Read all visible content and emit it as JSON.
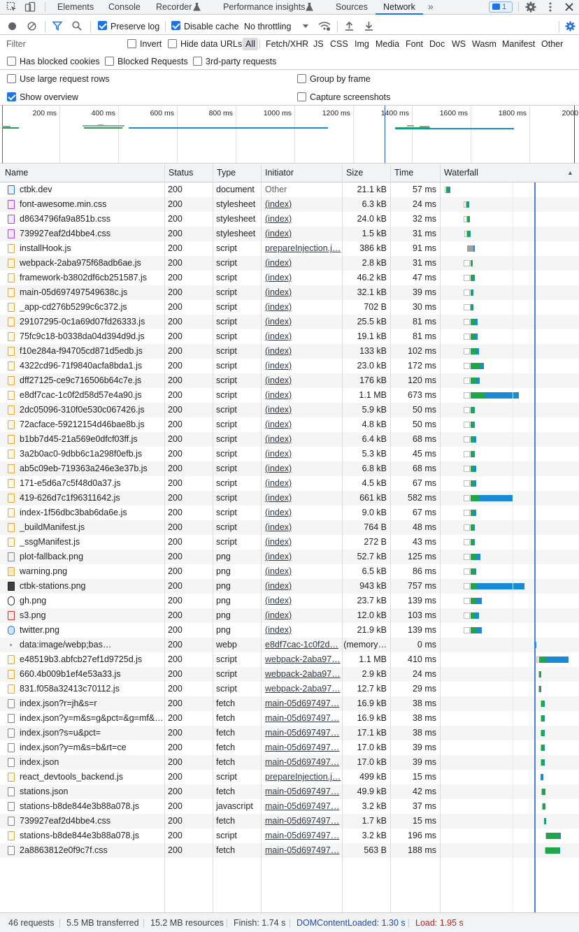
{
  "tabs": [
    {
      "label": "Elements",
      "active": false
    },
    {
      "label": "Console",
      "active": false
    },
    {
      "label": "Recorder",
      "active": false
    },
    {
      "label": "Performance insights",
      "active": false
    },
    {
      "label": "Sources",
      "active": false
    },
    {
      "label": "Network",
      "active": true
    }
  ],
  "issues_count": "1",
  "toolbar": {
    "preserve_log": "Preserve log",
    "disable_cache": "Disable cache",
    "throttling": "No throttling"
  },
  "filter": {
    "placeholder": "Filter",
    "invert": "Invert",
    "hide_data_urls": "Hide data URLs",
    "types": [
      "All",
      "Fetch/XHR",
      "JS",
      "CSS",
      "Img",
      "Media",
      "Font",
      "Doc",
      "WS",
      "Wasm",
      "Manifest",
      "Other"
    ],
    "selected_type": "All"
  },
  "blocked": {
    "has_blocked_cookies": "Has blocked cookies",
    "blocked_requests": "Blocked Requests",
    "third_party": "3rd-party requests"
  },
  "settings": {
    "large_rows": "Use large request rows",
    "group_by_frame": "Group by frame",
    "show_overview": "Show overview",
    "capture_screenshots": "Capture screenshots"
  },
  "overview": {
    "ticks": [
      "200 ms",
      "400 ms",
      "600 ms",
      "800 ms",
      "1000 ms",
      "1200 ms",
      "1400 ms",
      "1600 ms",
      "1800 ms",
      "2000"
    ]
  },
  "columns": [
    "Name",
    "Status",
    "Type",
    "Initiator",
    "Size",
    "Time",
    "Waterfall"
  ],
  "requests": [
    {
      "name": "ctbk.dev",
      "status": "200",
      "type": "document",
      "initiator": "Other",
      "size": "21.1 kB",
      "time": "57 ms",
      "icon": "doc"
    },
    {
      "name": "font-awesome.min.css",
      "status": "200",
      "type": "stylesheet",
      "initiator": "(index)",
      "size": "6.3 kB",
      "time": "24 ms",
      "icon": "css"
    },
    {
      "name": "d8634796fa9a851b.css",
      "status": "200",
      "type": "stylesheet",
      "initiator": "(index)",
      "size": "24.0 kB",
      "time": "32 ms",
      "icon": "css"
    },
    {
      "name": "739927eaf2d4bbe4.css",
      "status": "200",
      "type": "stylesheet",
      "initiator": "(index)",
      "size": "1.5 kB",
      "time": "31 ms",
      "icon": "css"
    },
    {
      "name": "installHook.js",
      "status": "200",
      "type": "script",
      "initiator": "prepareInjection.j…",
      "size": "386 kB",
      "time": "91 ms",
      "icon": "script"
    },
    {
      "name": "webpack-2aba975f68adb6ae.js",
      "status": "200",
      "type": "script",
      "initiator": "(index)",
      "size": "2.8 kB",
      "time": "31 ms",
      "icon": "script"
    },
    {
      "name": "framework-b3802df6cb251587.js",
      "status": "200",
      "type": "script",
      "initiator": "(index)",
      "size": "46.2 kB",
      "time": "47 ms",
      "icon": "script"
    },
    {
      "name": "main-05d697497549638c.js",
      "status": "200",
      "type": "script",
      "initiator": "(index)",
      "size": "32.1 kB",
      "time": "39 ms",
      "icon": "script"
    },
    {
      "name": "_app-cd276b5299c6c372.js",
      "status": "200",
      "type": "script",
      "initiator": "(index)",
      "size": "702 B",
      "time": "30 ms",
      "icon": "script"
    },
    {
      "name": "29107295-0c1a69d07fd26333.js",
      "status": "200",
      "type": "script",
      "initiator": "(index)",
      "size": "25.5 kB",
      "time": "81 ms",
      "icon": "script"
    },
    {
      "name": "75fc9c18-b0338da04d394d9d.js",
      "status": "200",
      "type": "script",
      "initiator": "(index)",
      "size": "19.1 kB",
      "time": "81 ms",
      "icon": "script"
    },
    {
      "name": "f10e284a-f94705cd871d5edb.js",
      "status": "200",
      "type": "script",
      "initiator": "(index)",
      "size": "133 kB",
      "time": "102 ms",
      "icon": "script"
    },
    {
      "name": "4322cd96-71f9840acfa8bda1.js",
      "status": "200",
      "type": "script",
      "initiator": "(index)",
      "size": "23.0 kB",
      "time": "172 ms",
      "icon": "script"
    },
    {
      "name": "dff27125-ce9c716506b64c7e.js",
      "status": "200",
      "type": "script",
      "initiator": "(index)",
      "size": "176 kB",
      "time": "120 ms",
      "icon": "script"
    },
    {
      "name": "e8df7cac-1c0f2d58d57e4a90.js",
      "status": "200",
      "type": "script",
      "initiator": "(index)",
      "size": "1.1 MB",
      "time": "673 ms",
      "icon": "script"
    },
    {
      "name": "2dc05096-310f0e530c067426.js",
      "status": "200",
      "type": "script",
      "initiator": "(index)",
      "size": "5.9 kB",
      "time": "50 ms",
      "icon": "script"
    },
    {
      "name": "72acface-59212154d46bae8b.js",
      "status": "200",
      "type": "script",
      "initiator": "(index)",
      "size": "4.8 kB",
      "time": "50 ms",
      "icon": "script"
    },
    {
      "name": "b1bb7d45-21a569e0dfcf03ff.js",
      "status": "200",
      "type": "script",
      "initiator": "(index)",
      "size": "6.4 kB",
      "time": "68 ms",
      "icon": "script"
    },
    {
      "name": "3a2b0ac0-9dbb6c1a298f0efb.js",
      "status": "200",
      "type": "script",
      "initiator": "(index)",
      "size": "5.3 kB",
      "time": "45 ms",
      "icon": "script"
    },
    {
      "name": "ab5c09eb-719363a246e3e37b.js",
      "status": "200",
      "type": "script",
      "initiator": "(index)",
      "size": "6.8 kB",
      "time": "68 ms",
      "icon": "script"
    },
    {
      "name": "171-e5d6a7c5f48d0a37.js",
      "status": "200",
      "type": "script",
      "initiator": "(index)",
      "size": "4.5 kB",
      "time": "67 ms",
      "icon": "script"
    },
    {
      "name": "419-626d7c1f96311642.js",
      "status": "200",
      "type": "script",
      "initiator": "(index)",
      "size": "661 kB",
      "time": "582 ms",
      "icon": "script"
    },
    {
      "name": "index-1f56dbc3bab6da6e.js",
      "status": "200",
      "type": "script",
      "initiator": "(index)",
      "size": "9.0 kB",
      "time": "67 ms",
      "icon": "script"
    },
    {
      "name": "_buildManifest.js",
      "status": "200",
      "type": "script",
      "initiator": "(index)",
      "size": "764 B",
      "time": "48 ms",
      "icon": "script"
    },
    {
      "name": "_ssgManifest.js",
      "status": "200",
      "type": "script",
      "initiator": "(index)",
      "size": "272 B",
      "time": "43 ms",
      "icon": "script"
    },
    {
      "name": "plot-fallback.png",
      "status": "200",
      "type": "png",
      "initiator": "(index)",
      "size": "52.7 kB",
      "time": "125 ms",
      "icon": "img"
    },
    {
      "name": "warning.png",
      "status": "200",
      "type": "png",
      "initiator": "(index)",
      "size": "6.5 kB",
      "time": "86 ms",
      "icon": "warn"
    },
    {
      "name": "ctbk-stations.png",
      "status": "200",
      "type": "png",
      "initiator": "(index)",
      "size": "943 kB",
      "time": "757 ms",
      "icon": "dark"
    },
    {
      "name": "gh.png",
      "status": "200",
      "type": "png",
      "initiator": "(index)",
      "size": "23.7 kB",
      "time": "139 ms",
      "icon": "gh"
    },
    {
      "name": "s3.png",
      "status": "200",
      "type": "png",
      "initiator": "(index)",
      "size": "12.0 kB",
      "time": "103 ms",
      "icon": "s3"
    },
    {
      "name": "twitter.png",
      "status": "200",
      "type": "png",
      "initiator": "(index)",
      "size": "21.9 kB",
      "time": "139 ms",
      "icon": "tw"
    },
    {
      "name": "data:image/webp;bas…",
      "status": "200",
      "type": "webp",
      "initiator": "e8df7cac-1c0f2d…",
      "size": "(memory…",
      "time": "0 ms",
      "icon": "data"
    },
    {
      "name": "e48519b3.abfcb27ef1d9725d.js",
      "status": "200",
      "type": "script",
      "initiator": "webpack-2aba97…",
      "size": "1.1 MB",
      "time": "410 ms",
      "icon": "script"
    },
    {
      "name": "660.4b009b1ef4e53a33.js",
      "status": "200",
      "type": "script",
      "initiator": "webpack-2aba97…",
      "size": "2.9 kB",
      "time": "24 ms",
      "icon": "script"
    },
    {
      "name": "831.f058a32413c70112.js",
      "status": "200",
      "type": "script",
      "initiator": "webpack-2aba97…",
      "size": "12.7 kB",
      "time": "29 ms",
      "icon": "script"
    },
    {
      "name": "index.json?r=jh&s=r",
      "status": "200",
      "type": "fetch",
      "initiator": "main-05d697497…",
      "size": "16.9 kB",
      "time": "38 ms",
      "icon": "file"
    },
    {
      "name": "index.json?y=m&s=g&pct=&g=mf&…",
      "status": "200",
      "type": "fetch",
      "initiator": "main-05d697497…",
      "size": "16.9 kB",
      "time": "38 ms",
      "icon": "file"
    },
    {
      "name": "index.json?s=u&pct=",
      "status": "200",
      "type": "fetch",
      "initiator": "main-05d697497…",
      "size": "17.1 kB",
      "time": "38 ms",
      "icon": "file"
    },
    {
      "name": "index.json?y=m&s=b&rt=ce",
      "status": "200",
      "type": "fetch",
      "initiator": "main-05d697497…",
      "size": "17.0 kB",
      "time": "39 ms",
      "icon": "file"
    },
    {
      "name": "index.json",
      "status": "200",
      "type": "fetch",
      "initiator": "main-05d697497…",
      "size": "17.0 kB",
      "time": "39 ms",
      "icon": "file"
    },
    {
      "name": "react_devtools_backend.js",
      "status": "200",
      "type": "script",
      "initiator": "prepareInjection.j…",
      "size": "499 kB",
      "time": "15 ms",
      "icon": "script"
    },
    {
      "name": "stations.json",
      "status": "200",
      "type": "fetch",
      "initiator": "main-05d697497…",
      "size": "49.9 kB",
      "time": "42 ms",
      "icon": "file"
    },
    {
      "name": "stations-b8de844e3b88a078.js",
      "status": "200",
      "type": "javascript",
      "initiator": "main-05d697497…",
      "size": "3.2 kB",
      "time": "37 ms",
      "icon": "file"
    },
    {
      "name": "739927eaf2d4bbe4.css",
      "status": "200",
      "type": "fetch",
      "initiator": "main-05d697497…",
      "size": "1.7 kB",
      "time": "15 ms",
      "icon": "file"
    },
    {
      "name": "stations-b8de844e3b88a078.js",
      "status": "200",
      "type": "script",
      "initiator": "main-05d697497…",
      "size": "3.2 kB",
      "time": "196 ms",
      "icon": "script"
    },
    {
      "name": "2a8863812e0f9c7f.css",
      "status": "200",
      "type": "fetch",
      "initiator": "main-05d697497…",
      "size": "563 B",
      "time": "188 ms",
      "icon": "file"
    }
  ],
  "statusbar": {
    "requests": "46 requests",
    "transferred": "5.5 MB transferred",
    "resources": "15.2 MB resources",
    "finish": "Finish: 1.74 s",
    "dcl": "DOMContentLoaded: 1.30 s",
    "load": "Load: 1.95 s"
  },
  "colors": {
    "accent": "#1a73e8",
    "waterfall_wait": "#1fa64a",
    "waterfall_download": "#1a8ad4",
    "dcl_line": "#1a4fb5",
    "load_line": "#c5221f"
  }
}
